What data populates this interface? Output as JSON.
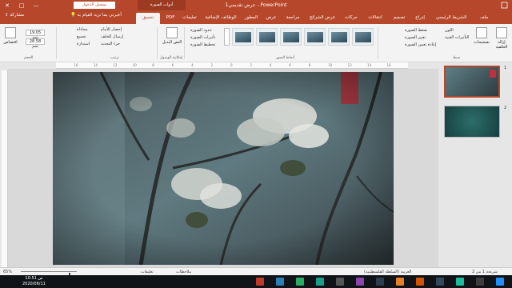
{
  "window": {
    "title": "عرض تقديمي1 - PowerPoint",
    "signin_label": "تسجيل الدخول",
    "context_title": "أدوات الصورة",
    "minimize": "—",
    "maximize": "□",
    "close": "✕"
  },
  "tabs": [
    "ملف",
    "الشريط الرئيسي",
    "إدراج",
    "تصميم",
    "انتقالات",
    "حركات",
    "عرض الشرائح",
    "مراجعة",
    "عرض",
    "المطور",
    "الوظائف الإضافية",
    "تعليمات",
    "PDF",
    "تنسيق"
  ],
  "active_tab": "تنسيق",
  "share_label": "مشاركة",
  "tell_me": "أخبرني بما تريد القيام به",
  "ribbon": {
    "adjust": {
      "label": "ضبط",
      "remove_bg": "إزالة الخلفية",
      "corrections": "تصحيحات",
      "color": "اللون",
      "artistic": "التأثيرات الفنية",
      "compress": "ضغط الصورة",
      "change": "تغيير الصورة",
      "reset": "إعادة تعيين الصورة"
    },
    "styles": {
      "label": "أنماط الصور",
      "border": "حدود الصورة",
      "effects": "تأثيرات الصورة",
      "layout": "تخطيط الصورة"
    },
    "accessibility": {
      "label": "إمكانية الوصول",
      "alt_text": "النص البديل"
    },
    "arrange": {
      "label": "ترتيب",
      "forward": "إحضار للأمام",
      "backward": "إرسال للخلف",
      "pane": "جزء التحديد",
      "align": "محاذاة",
      "group": "تجميع",
      "rotate": "استدارة"
    },
    "size": {
      "label": "الحجم",
      "height": "19.05 سم",
      "width": "28.58 سم",
      "crop": "اقتصاص"
    }
  },
  "ruler_ticks": [
    "16",
    "14",
    "12",
    "10",
    "8",
    "6",
    "4",
    "2",
    "0",
    "2",
    "4",
    "6",
    "8",
    "10",
    "12",
    "14",
    "16"
  ],
  "thumbnails": [
    {
      "num": "1",
      "active": true
    },
    {
      "num": "2",
      "active": false
    }
  ],
  "status": {
    "slide": "شريحة 1 من 2",
    "language": "العربية (السلطة الفلسطينية)",
    "notes": "ملاحظات",
    "comments": "تعليقات",
    "zoom": "65%"
  },
  "taskbar": {
    "time": "10:51 ص",
    "date": "2020/06/11"
  },
  "colors": {
    "accent": "#b7472a",
    "taskbar": "#101418"
  }
}
